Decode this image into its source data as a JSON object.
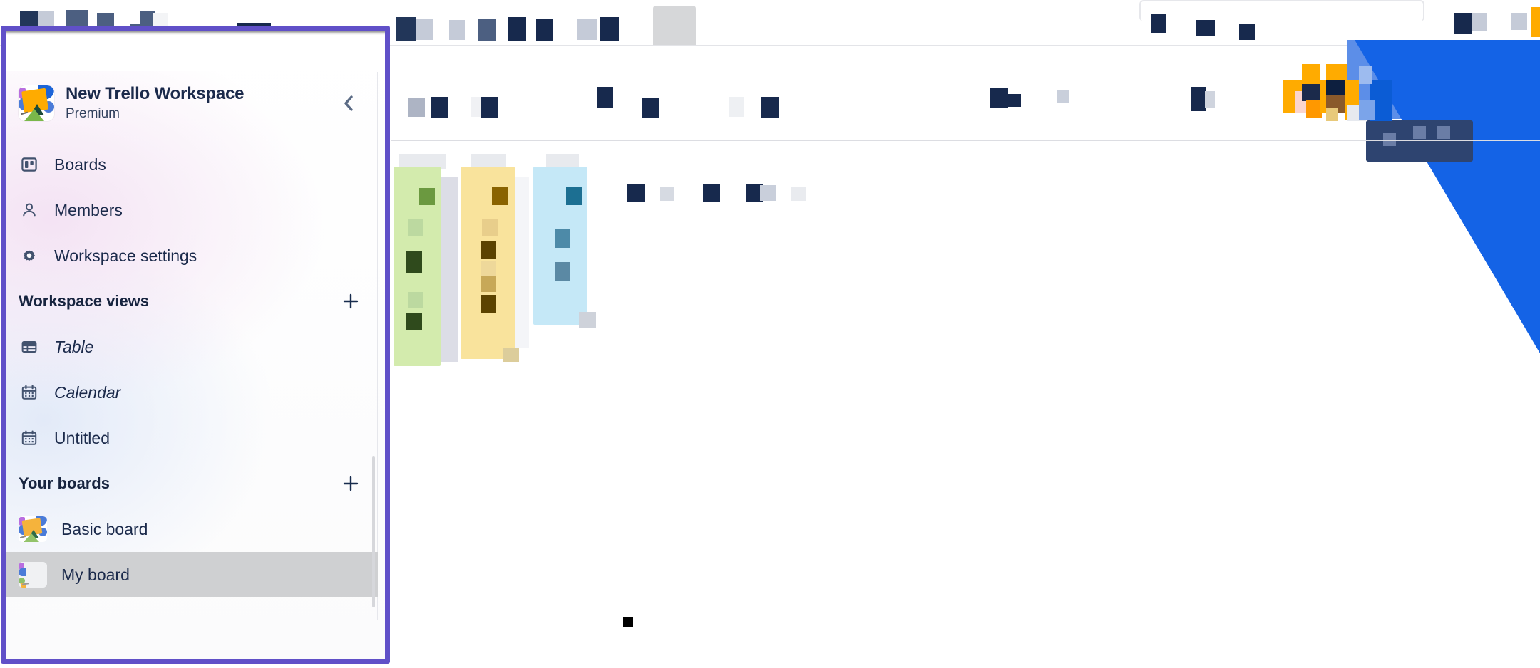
{
  "app": {
    "name": "Trello",
    "window_title": "New Trello Workspace"
  },
  "sidebar": {
    "workspace": {
      "name": "New Trello Workspace",
      "plan": "Premium",
      "logo_icon": "trello-workspace-logo",
      "collapse_icon": "chevron-left-icon"
    },
    "nav_items": [
      {
        "label": "Boards",
        "icon": "board-icon"
      },
      {
        "label": "Members",
        "icon": "person-icon"
      },
      {
        "label": "Workspace settings",
        "icon": "gear-icon"
      }
    ],
    "views_section": {
      "title": "Workspace views",
      "add_icon": "plus-icon",
      "items": [
        {
          "label": "Table",
          "icon": "table-icon",
          "italic": true
        },
        {
          "label": "Calendar",
          "icon": "calendar-icon",
          "italic": true
        },
        {
          "label": "Untitled",
          "icon": "calendar-icon",
          "italic": false
        }
      ]
    },
    "boards_section": {
      "title": "Your boards",
      "add_icon": "plus-icon",
      "items": [
        {
          "label": "Basic board",
          "icon": "board-thumbnail",
          "selected": false
        },
        {
          "label": "My board",
          "icon": "board-thumbnail",
          "selected": true
        }
      ]
    }
  },
  "colors": {
    "highlight_border": "#6050c8",
    "text_primary": "#1b2a4b",
    "icon": "#42526e",
    "selected_row": "#cfd0d2",
    "accent_blue": "#1463e6",
    "accent_orange": "#ffab00",
    "card_green": "#d3ebad",
    "card_yellow": "#f9e39c",
    "card_blue": "#c5e8f7"
  }
}
